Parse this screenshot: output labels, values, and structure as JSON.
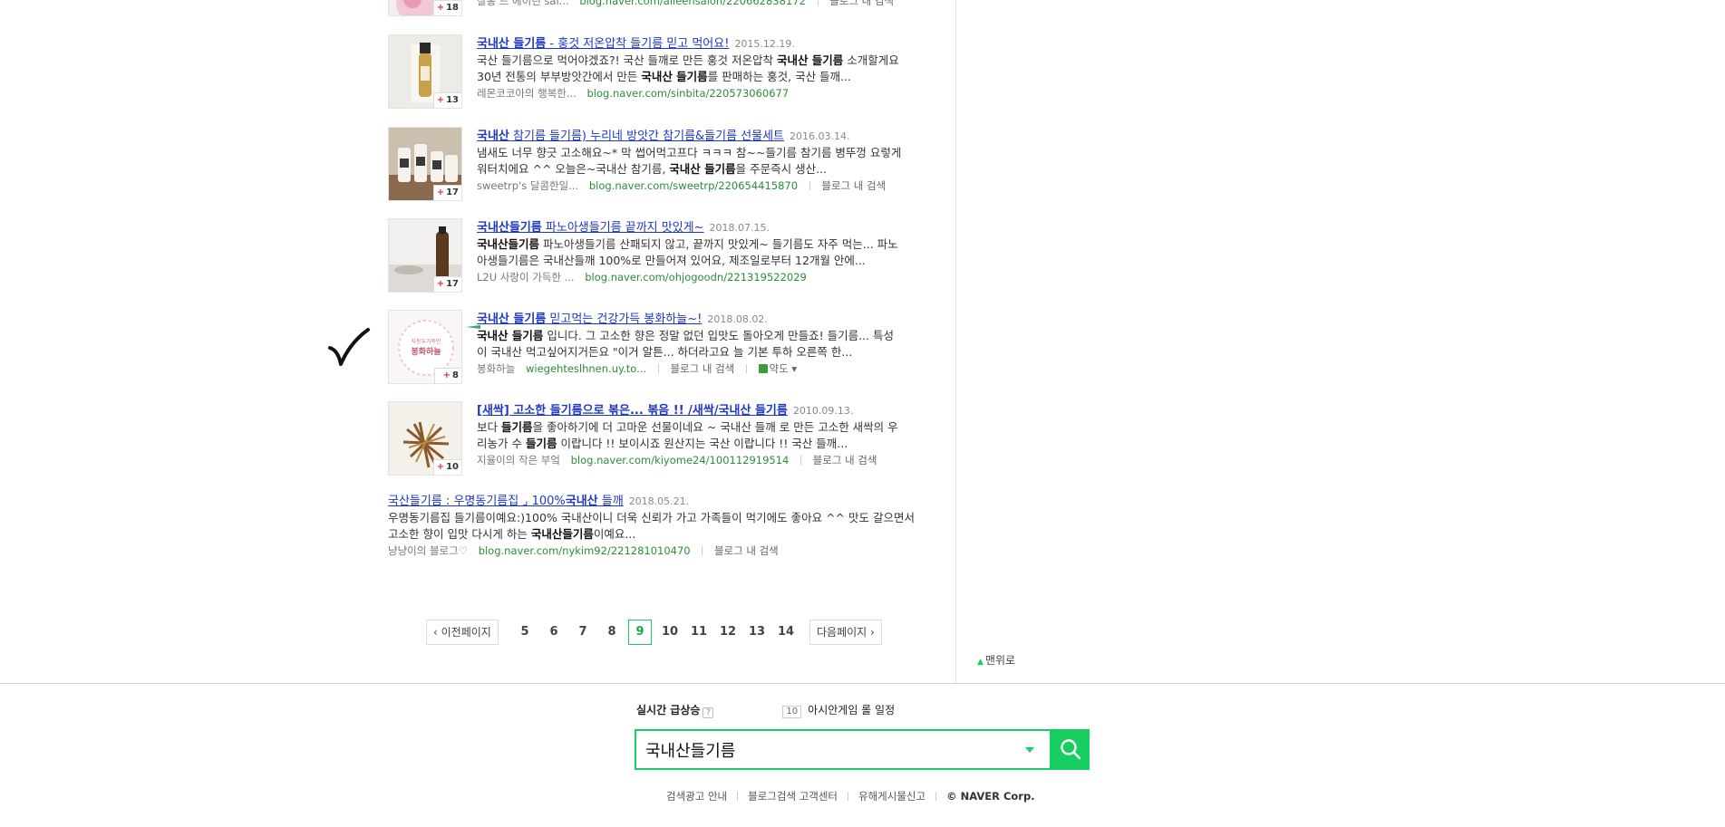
{
  "results": [
    {
      "author": "살롱 드 에이린 sal...",
      "url": "blog.naver.com/aileensalon/220662838172",
      "blog_search": "블로그 내 검색",
      "thumb_count": "18"
    },
    {
      "title_hl": "국내산 들기름",
      "title_rest": " - 훙것 저온압착 들기름 믿고 먹어요!",
      "date": "2015.12.19.",
      "desc_1a": "국산 들기름으로 먹어야겠죠?! 국산 들깨로 만든 훙것 저온압착 ",
      "desc_1b": "국내산 들기름",
      "desc_1c": " 소개할게요",
      "desc_2a": "30년 전통의 부부방앗간에서 만든 ",
      "desc_2b": "국내산 들기름",
      "desc_2c": "를 판매하는 훙것, 국산 들깨...",
      "author": "레몬코코아의 행복한...",
      "url": "blog.naver.com/sinbita/220573060677",
      "thumb_count": "13"
    },
    {
      "title_hl": "국내산",
      "title_rest": " 참기름 들기름) 누리네 방앗간 참기름&들기름 선물세트",
      "date": "2016.03.14.",
      "desc_1a": "냄새도 너무 향긋 고소해요~* 막 썹어먹고프다 ㅋㅋㅋ 참~~들기름 참기름 병뚜껑 요렇게",
      "desc_2a": "워터치에요 ^^ 오늘은~국내산 참기름, ",
      "desc_2b": "국내산 들기름",
      "desc_2c": "을 주문즉시 생산...",
      "author": "sweetrp's 달콤한일...",
      "url": "blog.naver.com/sweetrp/220654415870",
      "blog_search": "블로그 내 검색",
      "thumb_count": "17"
    },
    {
      "title_hl": "국내산들기름",
      "title_rest": " 파노아생들기름 끝까지 맛있게~",
      "date": "2018.07.15.",
      "desc_1b": "국내산들기름",
      "desc_1c": " 파노아생들기름 산패되지 않고, 끝까지 맛있게~ 들기름도 자주 먹는... 파노",
      "desc_2a": "아생들기름은 국내산들깨 100%로 만들어져 있어요, 제조일로부터 12개월 안에...",
      "author": "L2U 사랑이 가득한 ...",
      "url": "blog.naver.com/ohjogoodn/221319522029",
      "thumb_count": "17"
    },
    {
      "title_hl": "국내산 들기름",
      "title_rest": " 믿고먹는 건강가득 봉화하늘~!",
      "date": "2018.08.02.",
      "desc_1b": "국내산 들기름",
      "desc_1c": " 입니다. 그 고소한 향은 정말 없던 입맛도 돌아오게 만들죠! 들기름... 특성",
      "desc_2a": "이 국내산 먹고싶어지거든요 \"이거 알튼... 하더라고요 늘 기본 투하 오른쪽 한...",
      "author": "봉화하늘",
      "url": "wiegehteslhnen.uy.to...",
      "blog_search": "블로그 내 검색",
      "map_label": "약도",
      "thumb_count": "8",
      "thumb_text_1": "자동두가족만",
      "thumb_text_2": "봉화하늘"
    },
    {
      "title_hl": "[새싹] 고소한 들기름으로 볶은... 볶음 !! /새싹/국내산 들기름",
      "date": "2010.09.13.",
      "desc_1a": "보다 ",
      "desc_1b": "들기름",
      "desc_1c": "을 좋아하기에 더 고마운 선물이네요 ~ 국내산 들깨 로 만든 고소한 새싹의 우",
      "desc_2a": "리농가 수 ",
      "desc_2b": "들기름",
      "desc_2c": " 이랍니다 !! 보이시죠 원산지는 국산 이랍니다 !! 국산 들깨...",
      "author": "지율이의 작은 부엌",
      "url": "blog.naver.com/kiyome24/100112919514",
      "blog_search": "블로그 내 검색",
      "thumb_count": "10"
    },
    {
      "title_a": "국산들기름 : 우명동기름집 ⌟ 100%",
      "title_hl": "국내산",
      "title_rest": " 들깨",
      "date": "2018.05.21.",
      "desc_1a": "우명동기름집 들기름이예요:)100% 국내산이니 더욱 신뢰가 가고 가족들이 먹기에도 좋아요 ^^ 맛도 갈으면서",
      "desc_2a": "고소한 향이 입맛 다시게 하는 ",
      "desc_2b": "국내산들기름",
      "desc_2c": "이예요...",
      "author": "냥냥이의 블로그♡",
      "url": "blog.naver.com/nykim92/221281010470",
      "blog_search": "블로그 내 검색"
    }
  ],
  "pagination": {
    "prev": "이전페이지",
    "next": "다음페이지",
    "pages": [
      "5",
      "6",
      "7",
      "8",
      "9",
      "10",
      "11",
      "12",
      "13",
      "14"
    ],
    "current": "9"
  },
  "to_top": "맨위로",
  "footer": {
    "realtime_label": "실시간 급상승",
    "realtime_help": "?",
    "realtime_rank": "10",
    "realtime_keyword": "아시안게임 롤 일정",
    "search_value": "국내산들기름",
    "links": [
      "검색광고 안내",
      "블로그검색 고객센터",
      "유해게시물신고"
    ],
    "corp": "© NAVER Corp."
  },
  "colors": {
    "naver_green": "#19ce60",
    "title_blue": "#1f37c9",
    "url_green": "#2c8c3a"
  }
}
